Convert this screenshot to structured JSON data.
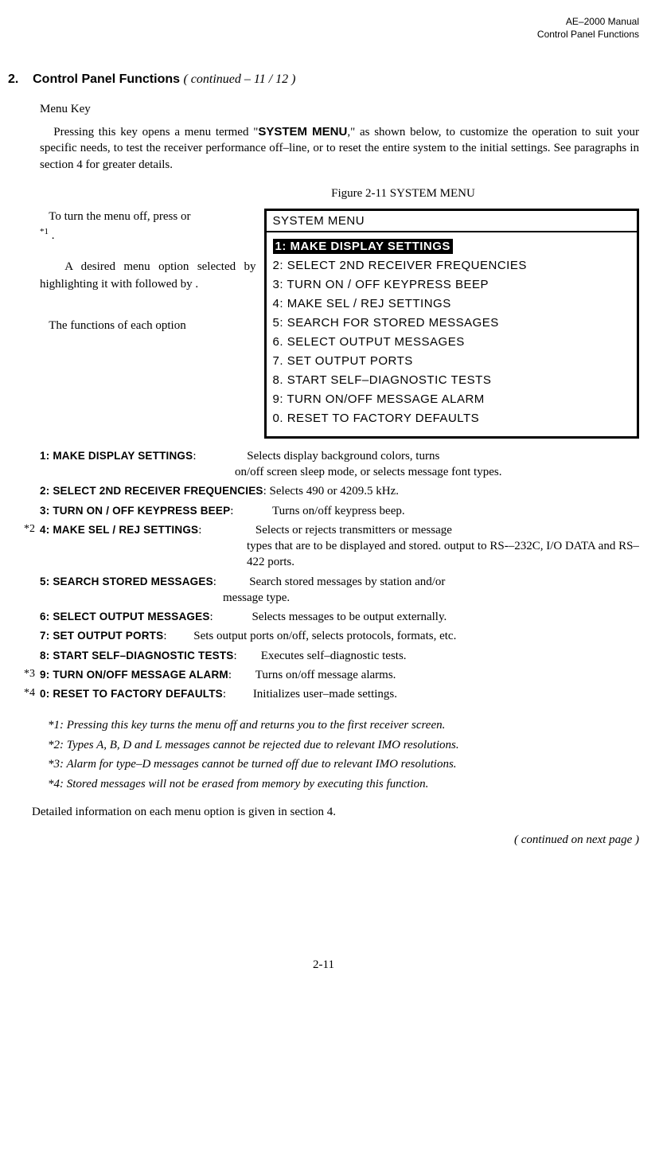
{
  "header": {
    "line1": "AE–2000 Manual",
    "line2": "Control Panel Functions"
  },
  "section": {
    "num": "2.",
    "title": "Control Panel Functions",
    "cont": "( continued – 11 / 12 )"
  },
  "menuKey": "Menu Key",
  "intro": {
    "p1a": "Pressing this key opens a menu termed \"",
    "p1b": "SYSTEM MENU",
    "p1c": ",\" as shown below, to customize the operation to suit your specific needs, to test the receiver performance off–line, or to reset the entire system to the initial settings. See paragraphs in section 4 for greater details."
  },
  "figCaption": "Figure 2-11   SYSTEM MENU",
  "leftCol": {
    "p1": "To turn the menu off, press    or",
    "p1sup": "*1",
    "p1end": "      .",
    "p2": "A desired menu option selected by highlighting it with    followed by       .",
    "p3": "The functions of each option"
  },
  "menuBox": {
    "title": "SYSTEM MENU",
    "items": [
      "1: MAKE DISPLAY SETTINGS",
      "2:  SELECT 2ND RECEIVER FREQUENCIES",
      "3:  TURN ON / OFF KEYPRESS BEEP",
      "4:  MAKE SEL / REJ SETTINGS",
      "5:  SEARCH FOR STORED MESSAGES",
      "6.  SELECT OUTPUT MESSAGES",
      "7.  SET OUTPUT PORTS",
      "8.  START SELF–DIAGNOSTIC TESTS",
      "9:  TURN ON/OFF MESSAGE ALARM",
      "0.  RESET TO FACTORY DEFAULTS"
    ]
  },
  "funcs": [
    {
      "star": "",
      "label": "1: MAKE DISPLAY SETTINGS",
      "colon": ":",
      "desc1": "Selects display background colors, turns",
      "desc2": "on/off screen sleep mode, or selects message font types."
    },
    {
      "star": "",
      "label": "2: SELECT 2ND RECEIVER FREQUENCIES",
      "colon": ":",
      "desc1": "Selects 490 or 4209.5 kHz.",
      "desc2": ""
    },
    {
      "star": "",
      "label": "3: TURN ON / OFF KEYPRESS BEEP",
      "colon": ":",
      "desc1": "Turns on/off keypress beep.",
      "desc2": ""
    },
    {
      "star": "*2",
      "label": "4: MAKE SEL / REJ SETTINGS",
      "colon": ":",
      "desc1": "Selects or rejects transmitters or message",
      "desc2": "types that are to be displayed and stored. output to RS-–232C, I/O DATA and RS–422 ports."
    },
    {
      "star": "",
      "label": "5: SEARCH STORED MESSAGES",
      "colon": ":",
      "desc1": "Search stored messages by station and/or",
      "desc2": "message type."
    },
    {
      "star": "",
      "label": "6: SELECT OUTPUT MESSAGES",
      "colon": ":",
      "desc1": "Selects messages to be output externally.",
      "desc2": ""
    },
    {
      "star": "",
      "label": "7: SET OUTPUT PORTS",
      "colon": ":",
      "desc1": "Sets output ports on/off, selects protocols, formats, etc.",
      "desc2": ""
    },
    {
      "star": "",
      "label": "8: START SELF–DIAGNOSTIC TESTS",
      "colon": ":",
      "desc1": "Executes self–diagnostic tests.",
      "desc2": ""
    },
    {
      "star": "*3",
      "label": "9: TURN ON/OFF MESSAGE ALARM",
      "colon": ":",
      "desc1": "Turns on/off message alarms.",
      "desc2": ""
    },
    {
      "star": "*4",
      "label": "0: RESET TO FACTORY DEFAULTS",
      "colon": ":",
      "desc1": "Initializes user–made settings.",
      "desc2": ""
    }
  ],
  "notes": [
    "*1: Pressing this key turns the menu off and returns you to the first receiver screen.",
    "*2: Types A, B, D and L messages cannot be rejected due to relevant IMO resolutions.",
    "*3: Alarm for type–D messages cannot be turned off due to relevant IMO resolutions.",
    "*4: Stored messages will not be erased from memory by executing this function."
  ],
  "closing": "Detailed information on each menu option is given in section 4.",
  "contNext": "( continued on next page )",
  "pageNum": "2-11"
}
